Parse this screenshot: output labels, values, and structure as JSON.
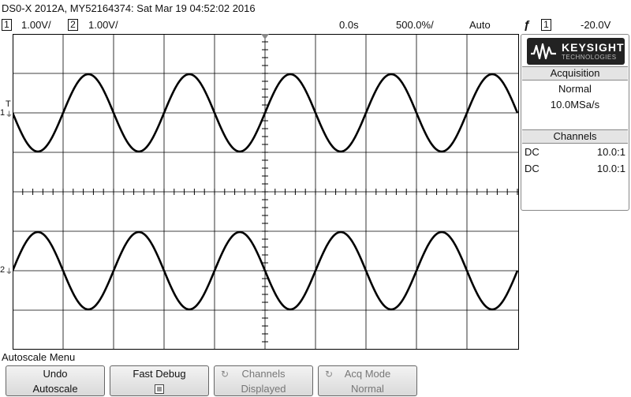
{
  "title": "DS0-X 2012A, MY52164374: Sat Mar 19 04:52:02 2016",
  "status": {
    "ch1_num": "1",
    "ch1_scale": "1.00V/",
    "ch2_num": "2",
    "ch2_scale": "1.00V/",
    "delay": "0.0s",
    "timebase": "500.0%/",
    "trigger_mode": "Auto",
    "trigger_icon": "rising-edge-icon",
    "trigger_source": "1",
    "trigger_level": "-20.0V"
  },
  "logo": {
    "name": "KEYSIGHT",
    "sub": "TECHNOLOGIES"
  },
  "acquisition": {
    "header": "Acquisition",
    "mode": "Normal",
    "rate": "10.0MSa/s"
  },
  "channels": {
    "header": "Channels",
    "rows": [
      {
        "coupling": "DC",
        "probe": "10.0:1"
      },
      {
        "coupling": "DC",
        "probe": "10.0:1"
      }
    ]
  },
  "graticule": {
    "ch1_marker": "1",
    "ch2_marker": "2",
    "trig_marker": "T",
    "waveform_color": "#000000",
    "grid_color": "#000000"
  },
  "menu": {
    "title": "Autoscale Menu",
    "keys": [
      {
        "line1": "Undo",
        "line2": "Autoscale"
      },
      {
        "line1": "Fast Debug",
        "line2": ""
      },
      {
        "line1": "Channels",
        "line2": "Displayed"
      },
      {
        "line1": "Acq Mode",
        "line2": "Normal"
      }
    ]
  }
}
